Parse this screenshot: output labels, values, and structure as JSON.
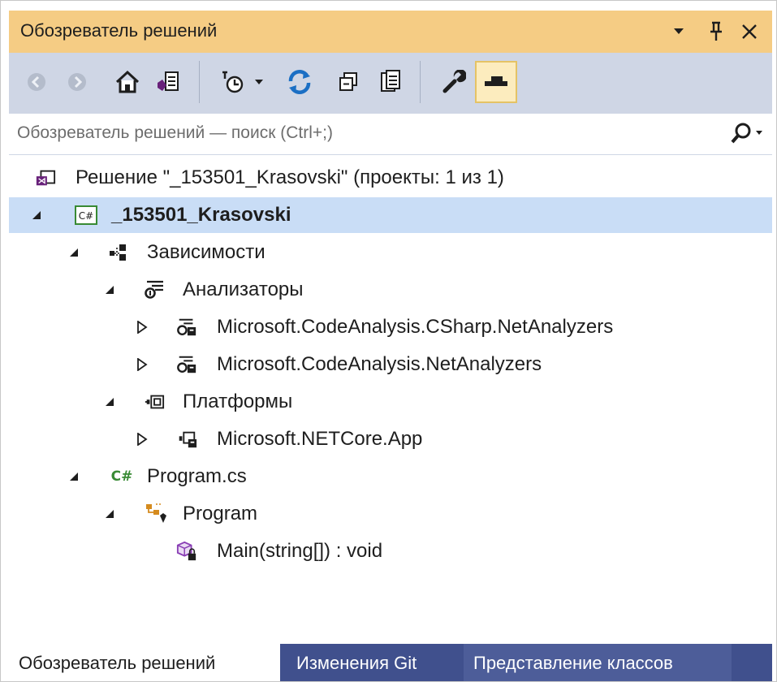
{
  "window": {
    "title": "Обозреватель решений",
    "dropdown_icon": "chevron-down-icon",
    "pin_icon": "pin-icon",
    "close_icon": "close-icon"
  },
  "toolbar": {
    "items": [
      "back-icon",
      "forward-icon",
      "home-icon",
      "switch-views-icon",
      "pending-changes-filter-icon",
      "dropdown-icon",
      "sync-icon",
      "collapse-all-icon",
      "show-all-files-icon",
      "properties-icon",
      "preview-selected-icon"
    ],
    "accent": "#1b6fc4"
  },
  "search": {
    "placeholder": "Обозреватель решений — поиск (Ctrl+;)"
  },
  "tree": {
    "solution": "Решение \"_153501_Krasovski\" (проекты: 1 из 1)",
    "project": "_153501_Krasovski",
    "dependencies": "Зависимости",
    "analyzers": "Анализаторы",
    "analyzer_items": [
      "Microsoft.CodeAnalysis.CSharp.NetAnalyzers",
      "Microsoft.CodeAnalysis.NetAnalyzers"
    ],
    "frameworks": "Платформы",
    "framework_item": "Microsoft.NETCore.App",
    "file": "Program.cs",
    "class": "Program",
    "method": "Main(string[]) : void",
    "csharp_badge": "C#",
    "csharp_file_badge": "C#"
  },
  "tabs": [
    "Обозреватель решений",
    "Изменения Git",
    "Представление классов"
  ],
  "colors": {
    "title_bg": "#f5cc84",
    "toolbar_bg": "#cfd6e5",
    "selected_row": "#c9ddf6",
    "tab_bar": "#40508d",
    "csharp_green": "#388a34",
    "vs_purple": "#68217a"
  }
}
